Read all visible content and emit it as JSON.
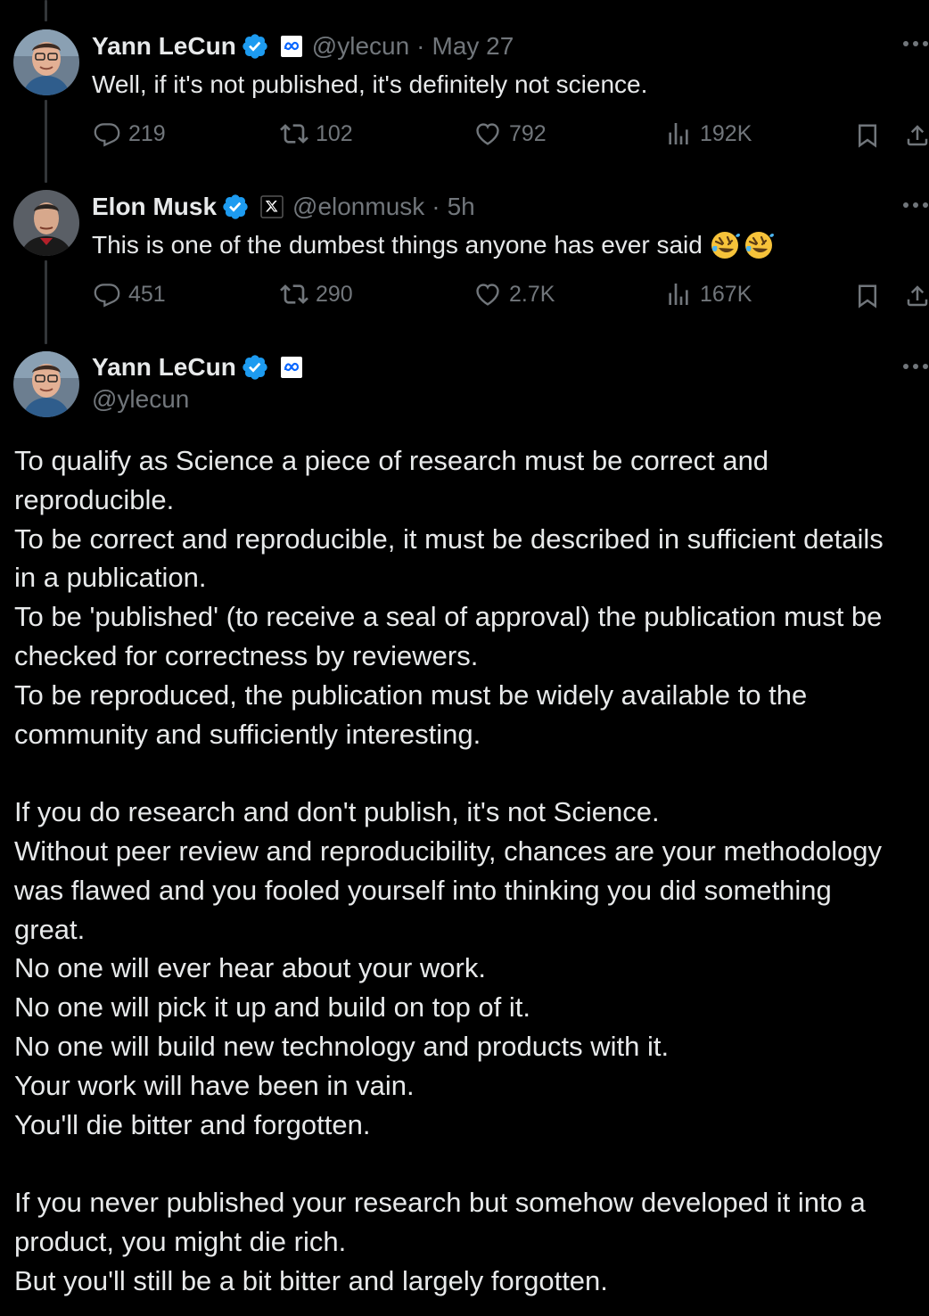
{
  "tweets": [
    {
      "author": {
        "name": "Yann LeCun",
        "handle": "@ylecun",
        "affiliation": "meta-logo"
      },
      "separator": "·",
      "date": "May 27",
      "text": "Well, if it's not published, it's definitely not science.",
      "stats": {
        "replies": "219",
        "reposts": "102",
        "likes": "792",
        "views": "192K"
      }
    },
    {
      "author": {
        "name": "Elon Musk",
        "handle": "@elonmusk",
        "affiliation": "x-logo"
      },
      "separator": "·",
      "date": "5h",
      "text": "This is one of the dumbest things anyone has ever said",
      "emoji": [
        "rolling-on-floor-laughing",
        "rolling-on-floor-laughing"
      ],
      "stats": {
        "replies": "451",
        "reposts": "290",
        "likes": "2.7K",
        "views": "167K"
      }
    }
  ],
  "main_tweet": {
    "author": {
      "name": "Yann LeCun",
      "handle": "@ylecun",
      "affiliation": "meta-logo"
    },
    "paragraphs": [
      [
        "To qualify as Science a piece of research must be correct and",
        "reproducible.",
        "To be correct and reproducible, it must be described in sufficient details",
        "in a publication.",
        "To be 'published' (to receive a seal of approval) the publication must be",
        "checked for correctness by reviewers.",
        "To be reproduced, the publication must be widely available to the",
        "community and sufficiently interesting."
      ],
      [
        "If you do research and don't publish, it's not Science.",
        "Without peer review and reproducibility, chances are your methodology",
        "was flawed and you fooled yourself into thinking you did something",
        "great.",
        "No one will ever hear about your work.",
        "No one will pick it up and build on top of it.",
        "No one will build new technology and products with it.",
        "Your work will have been in vain.",
        "You'll die bitter and forgotten."
      ],
      [
        "If you never published your research but somehow developed it into a",
        "product, you might die rich.",
        "But you'll still be a bit bitter and largely forgotten."
      ]
    ]
  },
  "icons": {
    "reply": "reply-icon",
    "repost": "repost-icon",
    "like": "like-icon",
    "views": "views-icon",
    "bookmark": "bookmark-icon",
    "share": "share-icon",
    "more": "more-icon",
    "verified": "verified-badge-icon"
  },
  "colors": {
    "background": "#000000",
    "text": "#e7e9ea",
    "secondary": "#71767b",
    "verified": "#1d9bf0"
  }
}
